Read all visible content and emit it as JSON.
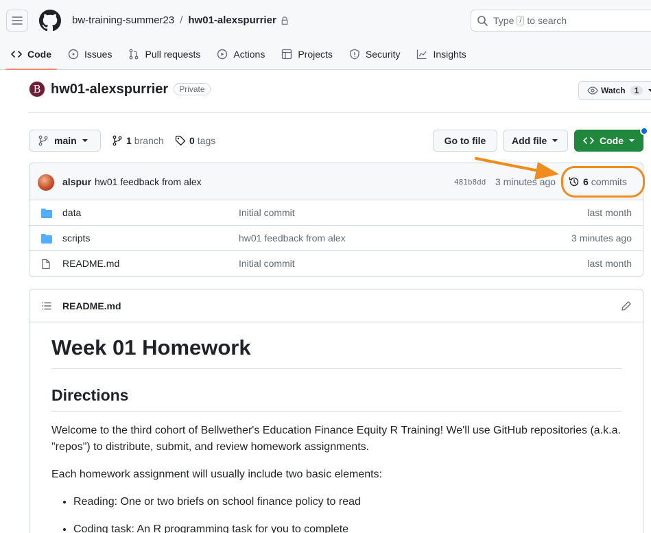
{
  "header": {
    "org": "bw-training-summer23",
    "separator": "/",
    "repo": "hw01-alexspurrier",
    "search": {
      "prefix": "Type",
      "key": "/",
      "suffix": "to search"
    }
  },
  "nav": [
    {
      "label": "Code",
      "icon": "code-icon",
      "active": true
    },
    {
      "label": "Issues",
      "icon": "issue-icon"
    },
    {
      "label": "Pull requests",
      "icon": "pull-request-icon"
    },
    {
      "label": "Actions",
      "icon": "play-icon"
    },
    {
      "label": "Projects",
      "icon": "table-icon"
    },
    {
      "label": "Security",
      "icon": "shield-icon"
    },
    {
      "label": "Insights",
      "icon": "graph-icon"
    }
  ],
  "repo": {
    "avatar_letter": "B",
    "name": "hw01-alexspurrier",
    "visibility": "Private",
    "watch_label": "Watch",
    "watch_count": "1"
  },
  "toolbar": {
    "branch": "main",
    "branch_count": "1",
    "branch_word": "branch",
    "tag_count": "0",
    "tag_word": "tags",
    "go_to_file": "Go to file",
    "add_file": "Add file",
    "code": "Code"
  },
  "commit": {
    "author": "alspur",
    "message": "hw01 feedback from alex",
    "sha": "481b8dd",
    "time": "3 minutes ago",
    "count": "6",
    "count_word": "commits"
  },
  "files": [
    {
      "name": "data",
      "type": "folder",
      "message": "Initial commit",
      "time": "last month"
    },
    {
      "name": "scripts",
      "type": "folder",
      "message": "hw01 feedback from alex",
      "time": "3 minutes ago"
    },
    {
      "name": "README.md",
      "type": "file",
      "message": "Initial commit",
      "time": "last month"
    }
  ],
  "readme": {
    "title": "README.md",
    "h1": "Week 01 Homework",
    "h2": "Directions",
    "p1": "Welcome to the third cohort of Bellwether's Education Finance Equity R Training! We'll use GitHub repositories (a.k.a. \"repos\") to distribute, submit, and review homework assignments.",
    "p2": "Each homework assignment will usually include two basic elements:",
    "bullets": [
      "Reading: One or two briefs on school finance policy to read",
      "Coding task: An R programming task for you to complete"
    ]
  },
  "colors": {
    "accent": "#f08b1d",
    "green": "#1f883d",
    "folder": "#54aeff"
  }
}
